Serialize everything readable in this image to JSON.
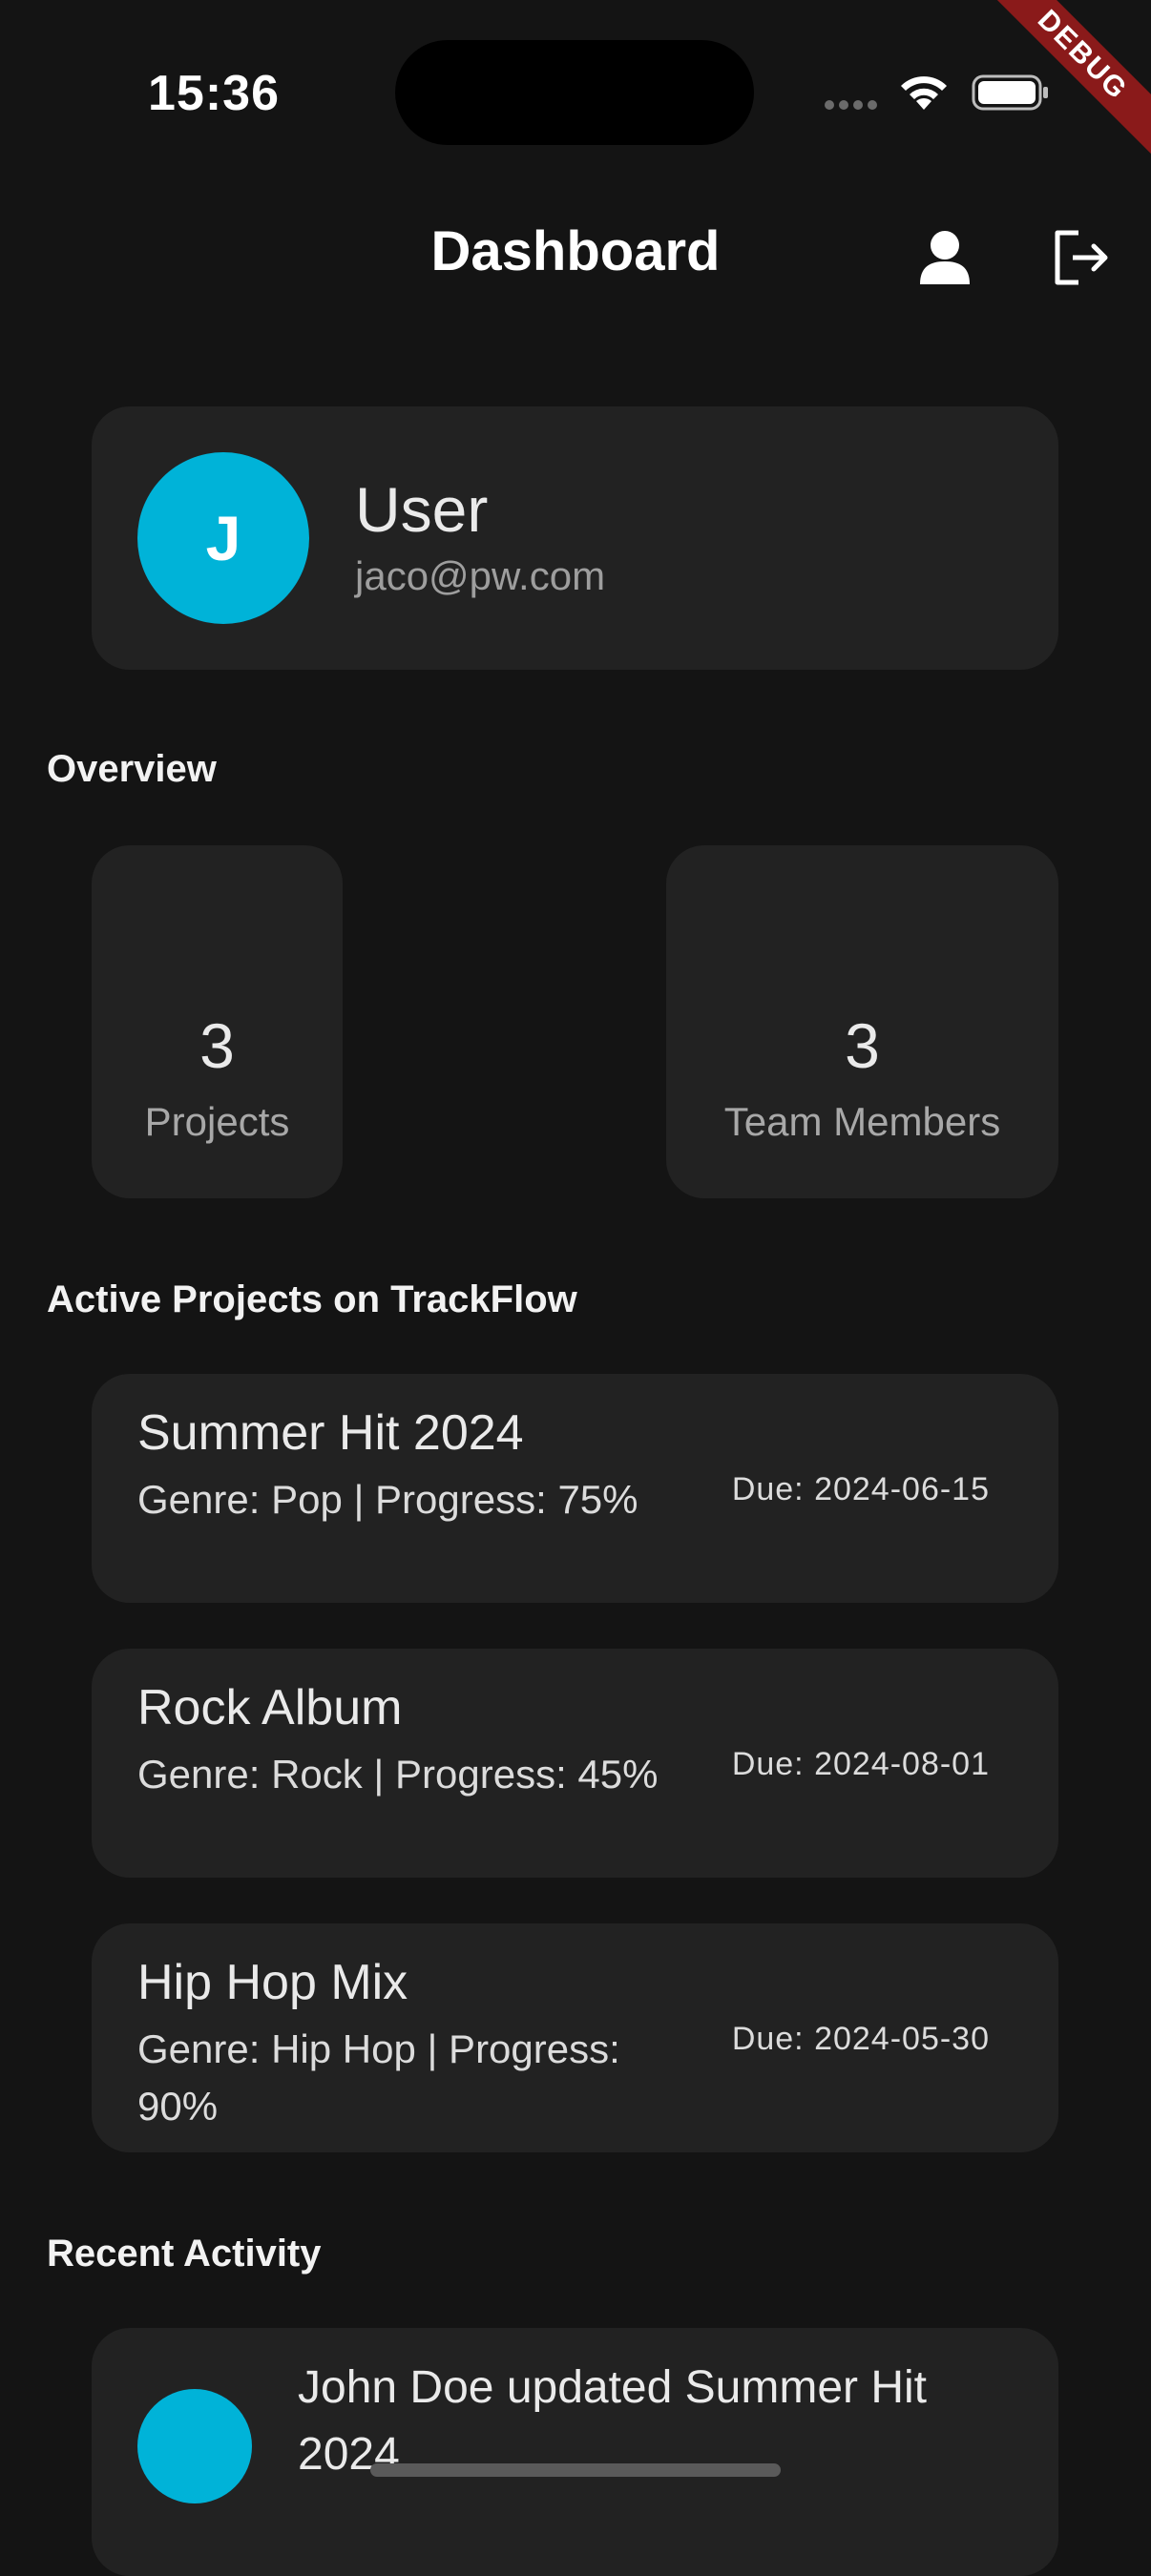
{
  "status_bar": {
    "time": "15:36",
    "icons": [
      "signal-dots-icon",
      "wifi-icon",
      "battery-icon"
    ],
    "debug_banner": "DEBUG"
  },
  "app_bar": {
    "title": "Dashboard",
    "actions": [
      "profile-icon",
      "logout-icon"
    ]
  },
  "user": {
    "avatar_letter": "J",
    "name": "User",
    "email": "jaco@pw.com",
    "avatar_color": "#00b3d8"
  },
  "overview": {
    "title": "Overview",
    "stats": [
      {
        "value": "3",
        "label": "Projects"
      },
      {
        "value": "3",
        "label": "Team Members"
      }
    ]
  },
  "projects": {
    "title": "Active Projects on TrackFlow",
    "items": [
      {
        "name": "Summer Hit 2024",
        "meta": "Genre: Pop | Progress: 75%",
        "due": "Due: 2024-06-15"
      },
      {
        "name": "Rock Album",
        "meta": "Genre: Rock | Progress: 45%",
        "due": "Due: 2024-08-01"
      },
      {
        "name": "Hip Hop Mix",
        "meta": "Genre: Hip Hop | Progress: 90%",
        "due": "Due: 2024-05-30"
      }
    ]
  },
  "activity": {
    "title": "Recent Activity",
    "items": [
      {
        "text": "John Doe updated Summer Hit 2024"
      }
    ]
  },
  "colors": {
    "background": "#141414",
    "card": "#222222",
    "accent": "#00b3d8",
    "debug_ribbon": "#8a1a1a"
  }
}
